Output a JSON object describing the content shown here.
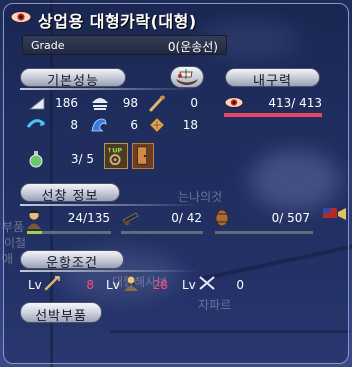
{
  "window": {
    "title": "상업용 대형카락(대형)"
  },
  "grade": {
    "label": "Grade",
    "value": "0(운송선)"
  },
  "sections": {
    "basic_performance": "기본성능",
    "durability": "내구력",
    "cabin_info": "선창 정보",
    "sailing_conditions": "운항조건"
  },
  "basic_stats": {
    "sail": "186",
    "hull": "98",
    "oar": "0",
    "turn": "8",
    "wave": "6",
    "armor": "18"
  },
  "durability": {
    "current": "413",
    "max": "413",
    "display": "413/ 413",
    "bar_fraction": 1.0
  },
  "crew_slots": {
    "display": "3/ 5"
  },
  "cabin": {
    "crew": "24/135",
    "cannon": "0/ 42",
    "cargo": "0/ 507"
  },
  "requirements": {
    "lv_label": "Lv",
    "adventure_lv": "8",
    "trade_lv": "28",
    "battle_lv": "0"
  },
  "buttons": {
    "ship_parts": "선박부품"
  },
  "overlay_text": {
    "line1": "는나의것",
    "line2": "부품",
    "line3": "이철",
    "line4": "애",
    "line5": "대항해사보",
    "line6": "자파르"
  },
  "colors": {
    "red_value": "#ff4a7a",
    "durability_bar": "#e04b62",
    "crew_bar": "#9fd34a",
    "cannon_bar": "#bf2f2f",
    "cargo_bar": "#c6a760"
  },
  "icons": [
    "eye-icon",
    "sail-icon",
    "hull-icon",
    "oar-icon",
    "turn-icon",
    "wave-icon",
    "armor-icon",
    "ship-view-icon",
    "durability-eye-icon",
    "crew-potion-icon",
    "upgrade-icon",
    "door-icon",
    "sailor-icon",
    "cannon-icon",
    "cargo-barrel-icon",
    "adventure-lv-icon",
    "trade-lv-icon",
    "battle-lv-icon"
  ]
}
